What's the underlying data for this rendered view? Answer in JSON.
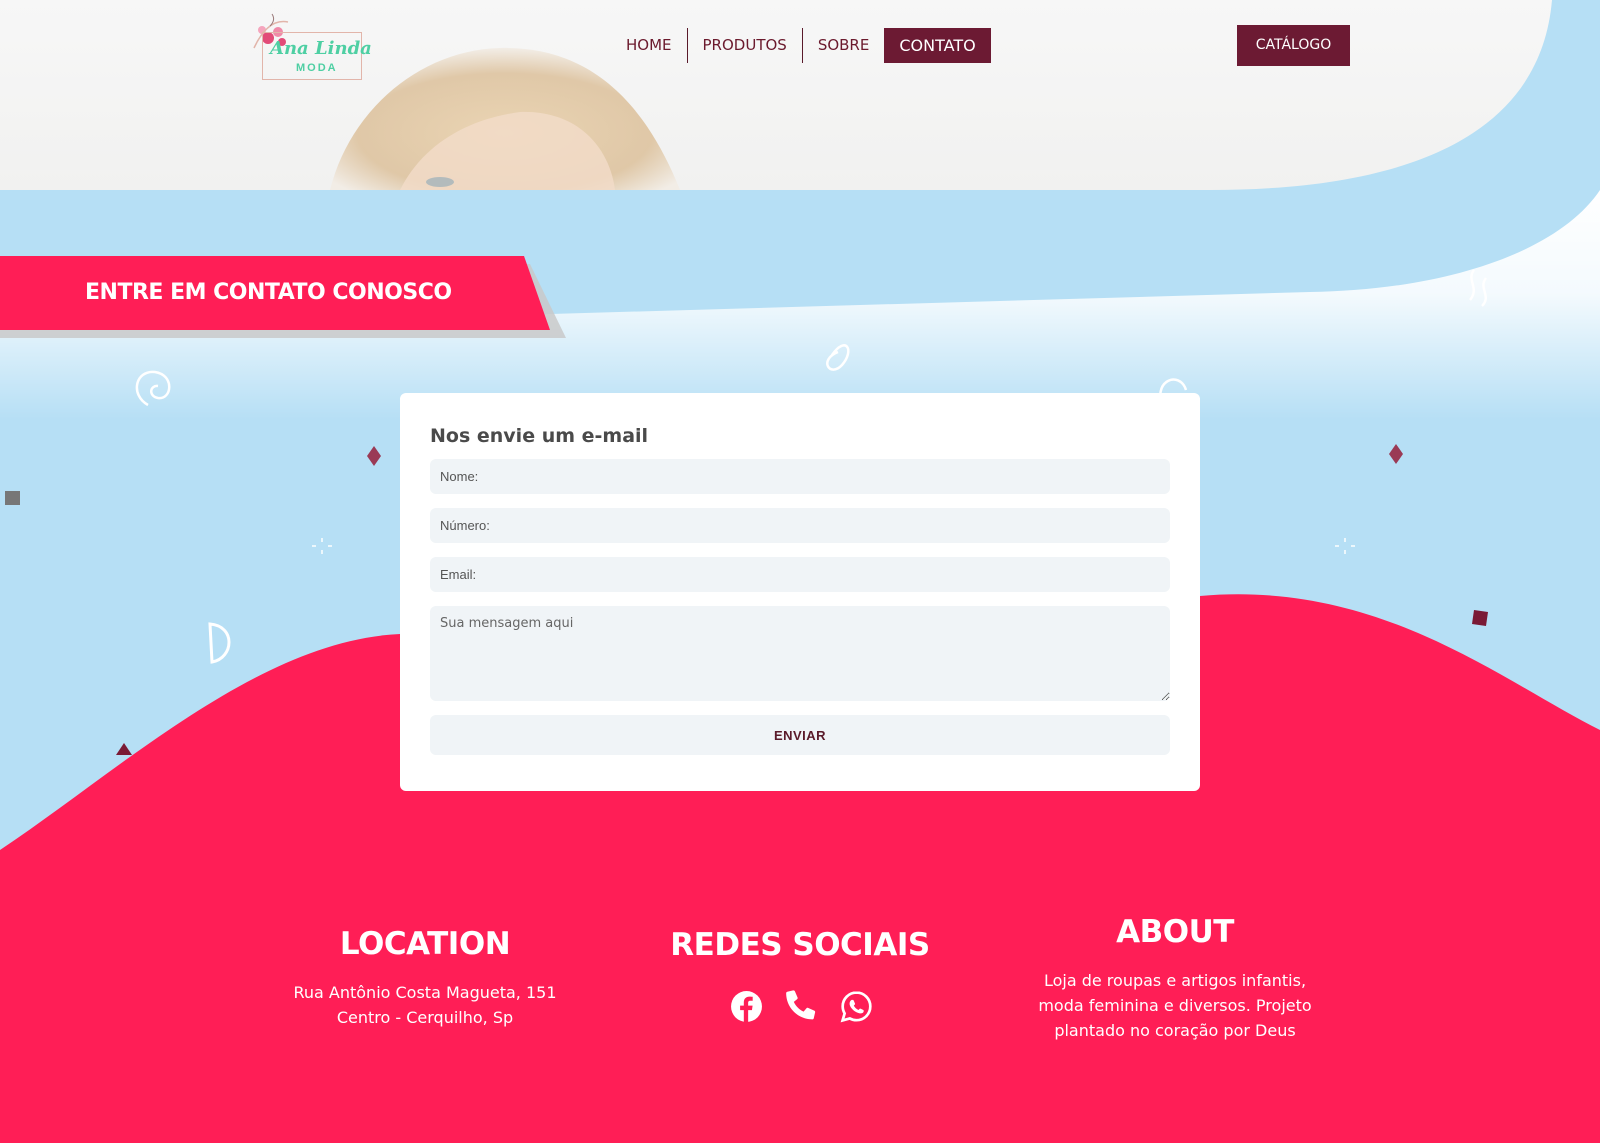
{
  "brand": {
    "name": "Ana Linda",
    "sub": "MODA"
  },
  "nav": {
    "items": [
      {
        "label": "HOME"
      },
      {
        "label": "PRODUTOS"
      },
      {
        "label": "SOBRE"
      },
      {
        "label": "CONTATO",
        "active": true
      }
    ],
    "catalog_label": "CATÁLOGO"
  },
  "contact": {
    "banner_title": "ENTRE EM CONTATO CONOSCO",
    "form_title": "Nos envie um e-mail",
    "fields": {
      "name_placeholder": "Nome:",
      "phone_placeholder": "Número:",
      "email_placeholder": "Email:",
      "message_placeholder": "Sua mensagem aqui"
    },
    "send_label": "ENVIAR"
  },
  "footer": {
    "location": {
      "title": "LOCATION",
      "line1": "Rua Antônio Costa Magueta, 151",
      "line2": "Centro - Cerquilho, Sp"
    },
    "social": {
      "title": "REDES SOCIAIS",
      "icons": [
        "facebook-icon",
        "phone-icon",
        "whatsapp-icon"
      ]
    },
    "about": {
      "title": "ABOUT",
      "line1": "Loja de roupas e artigos infantis,",
      "line2": "moda feminina e diversos. Projeto",
      "line3": "plantado no coração por Deus"
    }
  },
  "colors": {
    "accent": "#6c1a33",
    "pink": "#ff1e56",
    "sky": "#b6dff5",
    "field_bg": "#f0f4f7"
  }
}
